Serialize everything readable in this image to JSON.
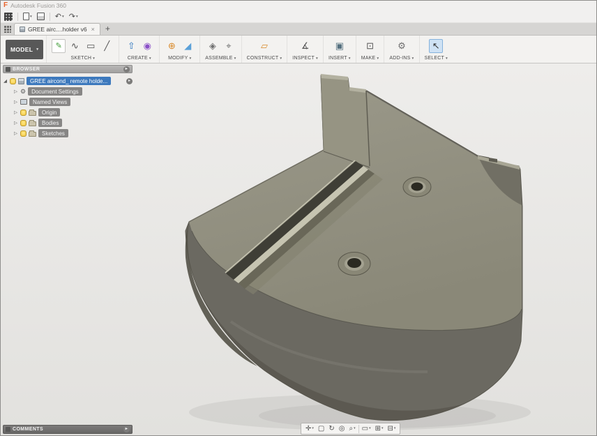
{
  "window": {
    "title": "Autodesk Fusion 360"
  },
  "quick_access": {
    "icons": [
      "app-grid-icon",
      "file-menu-icon",
      "save-icon",
      "undo-icon",
      "redo-icon"
    ]
  },
  "tab_bar": {
    "active_tab": "GREE airc....holder v6",
    "close_glyph": "×",
    "new_tab_glyph": "+"
  },
  "ribbon": {
    "workspace_label": "MODEL",
    "groups": [
      {
        "label": "SKETCH"
      },
      {
        "label": "CREATE"
      },
      {
        "label": "MODIFY"
      },
      {
        "label": "ASSEMBLE"
      },
      {
        "label": "CONSTRUCT"
      },
      {
        "label": "INSPECT"
      },
      {
        "label": "INSERT"
      },
      {
        "label": "MAKE"
      },
      {
        "label": "ADD-INS"
      },
      {
        "label": "SELECT"
      }
    ]
  },
  "browser": {
    "header_label": "BROWSER",
    "root_item": {
      "label": "GREE aircond_ remote holde..."
    },
    "items": [
      {
        "label": "Document Settings"
      },
      {
        "label": "Named Views"
      },
      {
        "label": "Origin"
      },
      {
        "label": "Bodies"
      },
      {
        "label": "Sketches"
      }
    ]
  },
  "comments_panel": {
    "label": "COMMENTS"
  },
  "viewport": {
    "content": "3D model of GREE aircond remote holder v6",
    "colors": {
      "top_face": "#93917f",
      "front_face": "#6b6961",
      "side_face": "#565449",
      "slot": "#3f3e36",
      "rail_highlight": "#c6c4b1",
      "background": "#e9e8e5"
    }
  }
}
